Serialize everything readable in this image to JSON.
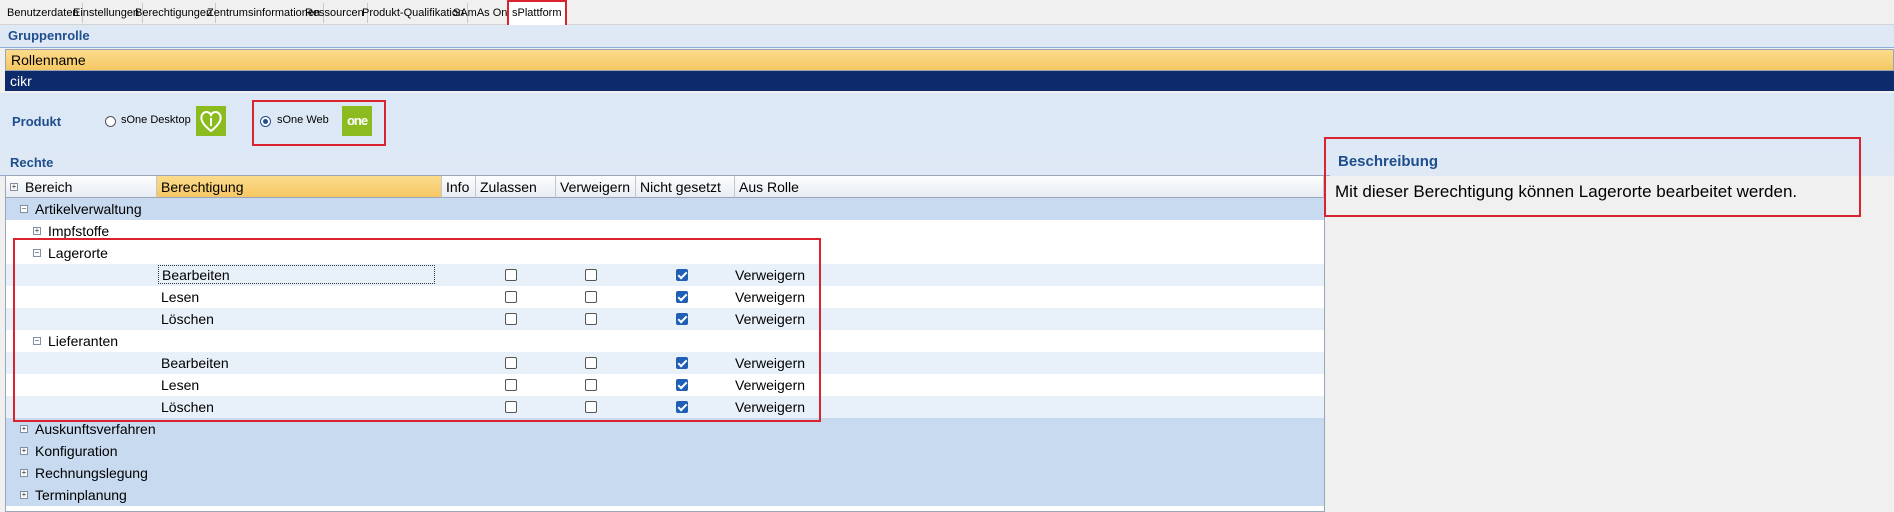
{
  "tabs": [
    {
      "label": "Benutzerdaten"
    },
    {
      "label": "Einstellungen"
    },
    {
      "label": "Berechtigungen"
    },
    {
      "label": "Zentrumsinformationen"
    },
    {
      "label": "Ressourcen"
    },
    {
      "label": "Produkt-Qualifikation"
    },
    {
      "label": "SAmAs One"
    },
    {
      "label": "sPlattform"
    }
  ],
  "active_tab": "sPlattform",
  "group_role": {
    "title": "Gruppenrolle",
    "column_header": "Rollenname",
    "selected_role": "cikr"
  },
  "product": {
    "label": "Produkt",
    "options": [
      {
        "label": "sOne Desktop",
        "selected": false,
        "icon": "sone-desktop-logo"
      },
      {
        "label": "sOne Web",
        "selected": true,
        "icon": "sone-web-logo",
        "logo_text": "one"
      }
    ]
  },
  "rights": {
    "title": "Rechte",
    "columns": [
      "Bereich",
      "Berechtigung",
      "Info",
      "Zulassen",
      "Verweigern",
      "Nicht gesetzt",
      "Aus Rolle"
    ],
    "tree": {
      "artikel": "Artikelverwaltung",
      "impfstoffe": "Impfstoffe",
      "lagerorte": "Lagerorte",
      "lieferanten": "Lieferanten",
      "auskunft": "Auskunftsverfahren",
      "konfiguration": "Konfiguration",
      "rechnung": "Rechnungslegung",
      "termin": "Terminplanung"
    },
    "lagerorte_rows": [
      {
        "permission": "Bearbeiten",
        "zulassen": false,
        "verweigern": false,
        "nicht_gesetzt": true,
        "aus_rolle": "Verweigern"
      },
      {
        "permission": "Lesen",
        "zulassen": false,
        "verweigern": false,
        "nicht_gesetzt": true,
        "aus_rolle": "Verweigern"
      },
      {
        "permission": "Löschen",
        "zulassen": false,
        "verweigern": false,
        "nicht_gesetzt": true,
        "aus_rolle": "Verweigern"
      }
    ],
    "lieferanten_rows": [
      {
        "permission": "Bearbeiten",
        "zulassen": false,
        "verweigern": false,
        "nicht_gesetzt": true,
        "aus_rolle": "Verweigern"
      },
      {
        "permission": "Lesen",
        "zulassen": false,
        "verweigern": false,
        "nicht_gesetzt": true,
        "aus_rolle": "Verweigern"
      },
      {
        "permission": "Löschen",
        "zulassen": false,
        "verweigern": false,
        "nicht_gesetzt": true,
        "aus_rolle": "Verweigern"
      }
    ]
  },
  "description": {
    "title": "Beschreibung",
    "text": "Mit dieser Berechtigung können Lagerorte bearbeitet werden."
  },
  "colors": {
    "accent_blue": "#1f4e8c",
    "selected_row": "#0d2a6b",
    "header_orange": "#f6c764",
    "highlight_red": "#d9232e",
    "logo_green": "#8bbb1e"
  }
}
